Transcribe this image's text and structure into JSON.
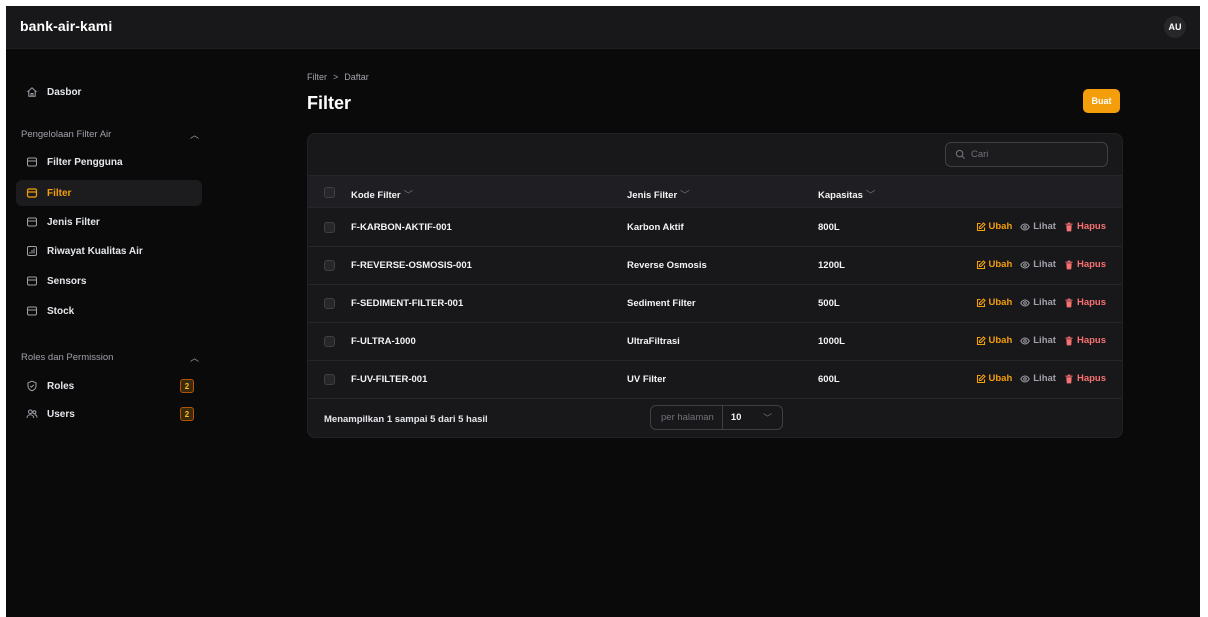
{
  "app": {
    "title": "bank-air-kami",
    "user_initials": "AU"
  },
  "colors": {
    "accent": "#f59e0b",
    "danger": "#f87171",
    "background": "#0a0a0b",
    "panel": "#18181b"
  },
  "sidebar": {
    "dashboard": {
      "label": "Dasbor",
      "icon": "home-icon"
    },
    "groups": [
      {
        "label": "Pengelolaan Filter Air",
        "items": [
          {
            "label": "Filter Pengguna",
            "icon": "box-icon"
          },
          {
            "label": "Filter",
            "icon": "box-icon",
            "active": true
          },
          {
            "label": "Jenis Filter",
            "icon": "box-icon"
          },
          {
            "label": "Riwayat Kualitas Air",
            "icon": "chart-icon"
          },
          {
            "label": "Sensors",
            "icon": "box-icon"
          },
          {
            "label": "Stock",
            "icon": "box-icon"
          }
        ]
      },
      {
        "label": "Roles dan Permission",
        "items": [
          {
            "label": "Roles",
            "icon": "shield-icon",
            "badge": "2"
          },
          {
            "label": "Users",
            "icon": "users-icon",
            "badge": "2"
          }
        ]
      }
    ]
  },
  "breadcrumb": {
    "parent": "Filter",
    "separator": ">",
    "current": "Daftar"
  },
  "page": {
    "title": "Filter",
    "create_label": "Buat"
  },
  "table": {
    "search_placeholder": "Cari",
    "columns": [
      "Kode Filter",
      "Jenis Filter",
      "Kapasitas"
    ],
    "rows": [
      {
        "kode": "F-KARBON-AKTIF-001",
        "jenis": "Karbon Aktif",
        "kapasitas": "800L"
      },
      {
        "kode": "F-REVERSE-OSMOSIS-001",
        "jenis": "Reverse Osmosis",
        "kapasitas": "1200L"
      },
      {
        "kode": "F-SEDIMENT-FILTER-001",
        "jenis": "Sediment Filter",
        "kapasitas": "500L"
      },
      {
        "kode": "F-ULTRA-1000",
        "jenis": "UltraFiltrasi",
        "kapasitas": "1000L"
      },
      {
        "kode": "F-UV-FILTER-001",
        "jenis": "UV Filter",
        "kapasitas": "600L"
      }
    ],
    "actions": {
      "edit": "Ubah",
      "view": "Lihat",
      "delete": "Hapus"
    },
    "summary": "Menampilkan 1 sampai 5 dari 5 hasil",
    "per_page_label": "per halaman",
    "per_page_value": "10"
  }
}
